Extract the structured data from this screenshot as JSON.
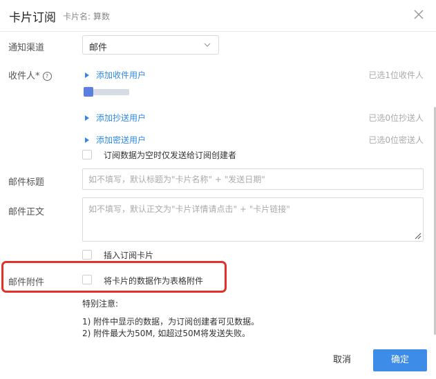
{
  "header": {
    "title": "卡片订阅",
    "subtitle": "卡片名: 算数",
    "close_icon": "close-icon"
  },
  "form": {
    "channel": {
      "label": "通知渠道",
      "value": "邮件"
    },
    "recipients": {
      "label": "收件人*",
      "help_icon": "question-circle-icon",
      "help_glyph": "?",
      "add_recipient": "添加收件用户",
      "recipient_count": "已选1位收件人",
      "add_cc": "添加抄送用户",
      "cc_count": "已选0位抄送人",
      "add_bcc": "添加密送用户",
      "bcc_count": "已选0位密送人",
      "empty_only_creator": "订阅数据为空时仅发送给订阅创建者"
    },
    "subject": {
      "label": "邮件标题",
      "placeholder": "如不填写，默认标题为\"卡片名称\" + \"发送日期\"",
      "value": ""
    },
    "body": {
      "label": "邮件正文",
      "placeholder": "如不填写，默认正文为\"卡片详情请点击\" + \"卡片链接\"",
      "value": ""
    },
    "insert_card": "插入订阅卡片",
    "attachment": {
      "label": "邮件附件",
      "option": "将卡片的数据作为表格附件"
    },
    "notes": {
      "title": "特别注意:",
      "line1": "1) 附件中显示的数据，为订阅创建者可见数据。",
      "line2": "2) 附件最大为50M, 如超过50M将发送失败。"
    }
  },
  "footer": {
    "cancel": "取消",
    "confirm": "确定"
  },
  "colors": {
    "accent": "#3d8de8",
    "link": "#2f88e5",
    "highlight": "#e33028"
  }
}
